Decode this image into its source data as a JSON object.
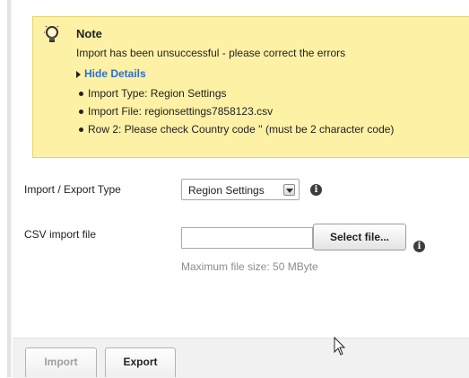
{
  "note": {
    "title": "Note",
    "message": "Import has been unsuccessful - please correct the errors",
    "toggle_label": "Hide Details",
    "details": [
      "Import Type: Region Settings",
      "Import File: regionsettings7858123.csv",
      "Row 2: Please check Country code '' (must be 2 character code)"
    ]
  },
  "form": {
    "type_label": "Import / Export Type",
    "type_value": "Region Settings",
    "file_label": "CSV import file",
    "file_value": "",
    "file_button": "Select file...",
    "file_hint": "Maximum file size: 50 MByte"
  },
  "actions": {
    "import_label": "Import",
    "export_label": "Export"
  },
  "icons": {
    "note": "lightbulb-icon",
    "info": "info-icon",
    "dropdown": "chevron-down-icon",
    "cursor": "mouse-pointer-icon"
  },
  "colors": {
    "note_background": "#fdf1a6",
    "link": "#2a6ed8",
    "disabled_text": "#a0a0a0"
  }
}
